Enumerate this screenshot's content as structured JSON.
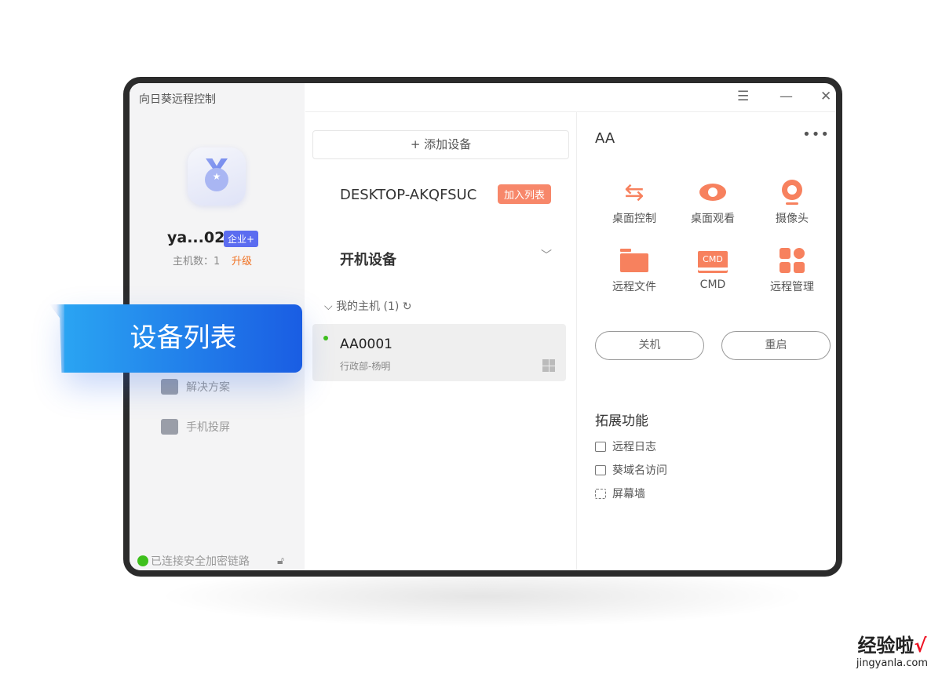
{
  "app": {
    "title": "向日葵远程控制"
  },
  "user": {
    "name": "ya...02",
    "badge": "企业+",
    "hosts": "主机数：1",
    "upgrade": "升级"
  },
  "sidebar": {
    "items": [
      {
        "label": "解决方案",
        "icon": "satellite-dish-icon"
      },
      {
        "label": "手机投屏",
        "icon": "screen-cast-icon"
      }
    ],
    "status": "已连接安全加密链路"
  },
  "banner": {
    "label": "设备列表"
  },
  "window_controls": {
    "menu": "☰",
    "minimize": "—",
    "close": "✕"
  },
  "middle": {
    "add_device": "+ 添加设备",
    "desktop_name": "DESKTOP-AKQFSUC",
    "join_list": "加入列表",
    "boot_devices": "开机设备",
    "group": "我的主机 (1)",
    "device": {
      "name": "AA0001",
      "sub": "行政部-杨明",
      "online": true,
      "os": "windows"
    }
  },
  "right": {
    "title": "AA",
    "more": "•••",
    "actions": [
      {
        "label": "桌面控制",
        "icon": "swap-arrows-icon"
      },
      {
        "label": "桌面观看",
        "icon": "eye-icon"
      },
      {
        "label": "摄像头",
        "icon": "webcam-icon"
      },
      {
        "label": "远程文件",
        "icon": "folder-icon"
      },
      {
        "label": "CMD",
        "icon": "cmd-monitor-icon",
        "icon_text": "CMD"
      },
      {
        "label": "远程管理",
        "icon": "grid-icon"
      }
    ],
    "shutdown": "关机",
    "restart": "重启",
    "ext_title": "拓展功能",
    "ext_items": [
      "远程日志",
      "葵域名访问",
      "屏幕墙"
    ]
  },
  "accent": "#f7815e",
  "watermark": {
    "line1": "经验啦",
    "check": "√",
    "line2": "jingyanla.com"
  }
}
